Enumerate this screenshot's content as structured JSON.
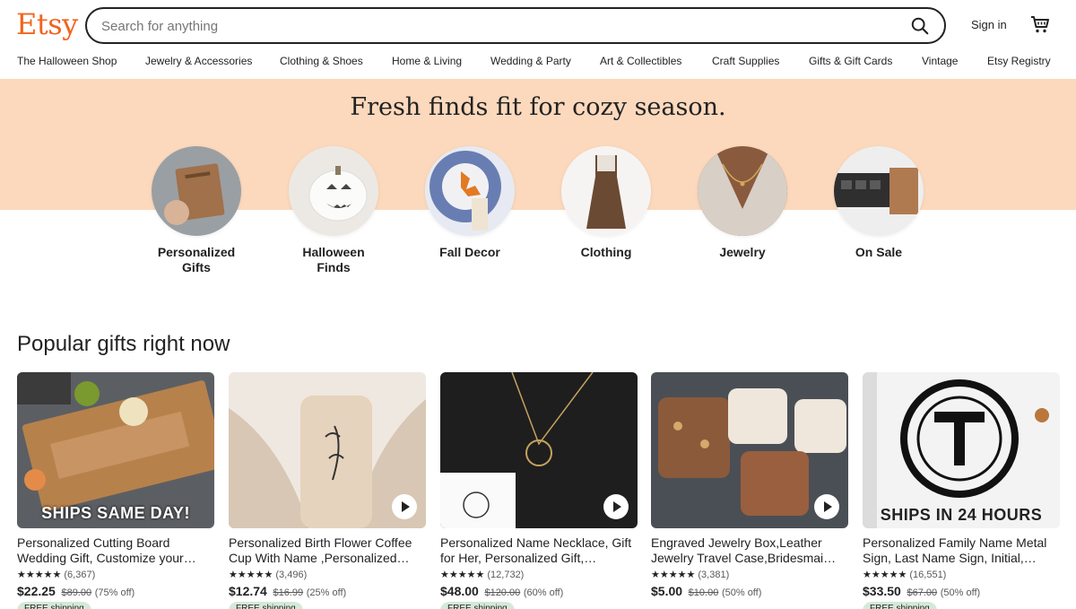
{
  "header": {
    "logo": "Etsy",
    "search_placeholder": "Search for anything",
    "signin_label": "Sign in"
  },
  "nav": [
    "The Halloween Shop",
    "Jewelry & Accessories",
    "Clothing & Shoes",
    "Home & Living",
    "Wedding & Party",
    "Art & Collectibles",
    "Craft Supplies",
    "Gifts & Gift Cards",
    "Vintage",
    "Etsy Registry"
  ],
  "hero": {
    "title": "Fresh finds fit for cozy season.",
    "categories": [
      {
        "label": "Personalized\nGifts"
      },
      {
        "label": "Halloween\nFinds"
      },
      {
        "label": "Fall Decor"
      },
      {
        "label": "Clothing"
      },
      {
        "label": "Jewelry"
      },
      {
        "label": "On Sale"
      }
    ]
  },
  "popular": {
    "title": "Popular gifts right now",
    "items": [
      {
        "title": "Personalized Cutting Board Wedding Gift, Customize your…",
        "stars": "★★★★★",
        "reviews": "(6,367)",
        "price": "$22.25",
        "original": "$89.00",
        "discount": "(75% off)",
        "overlay": "SHIPS SAME DAY!",
        "badge": "FREE shipping"
      },
      {
        "title": "Personalized Birth Flower Coffee Cup With Name ,Personalized…",
        "stars": "★★★★★",
        "reviews": "(3,496)",
        "price": "$12.74",
        "original": "$16.99",
        "discount": "(25% off)",
        "overlay": "",
        "badge": "FREE shipping"
      },
      {
        "title": "Personalized Name Necklace, Gift for Her, Personalized Gift,…",
        "stars": "★★★★★",
        "reviews": "(12,732)",
        "price": "$48.00",
        "original": "$120.00",
        "discount": "(60% off)",
        "overlay": "",
        "badge": "FREE shipping"
      },
      {
        "title": "Engraved Jewelry Box,Leather Jewelry Travel Case,Bridesmai…",
        "stars": "★★★★★",
        "reviews": "(3,381)",
        "price": "$5.00",
        "original": "$10.00",
        "discount": "(50% off)",
        "overlay": "",
        "badge": ""
      },
      {
        "title": "Personalized Family Name Metal Sign, Last Name Sign, Initial,…",
        "stars": "★★★★★",
        "reviews": "(16,551)",
        "price": "$33.50",
        "original": "$67.00",
        "discount": "(50% off)",
        "overlay": "SHIPS IN 24 HOURS",
        "badge": "FREE shipping"
      }
    ]
  },
  "colors": {
    "brand": "#f1641e",
    "hero_band": "#fcd9bd",
    "free_shipping": "#d4e9d7"
  }
}
